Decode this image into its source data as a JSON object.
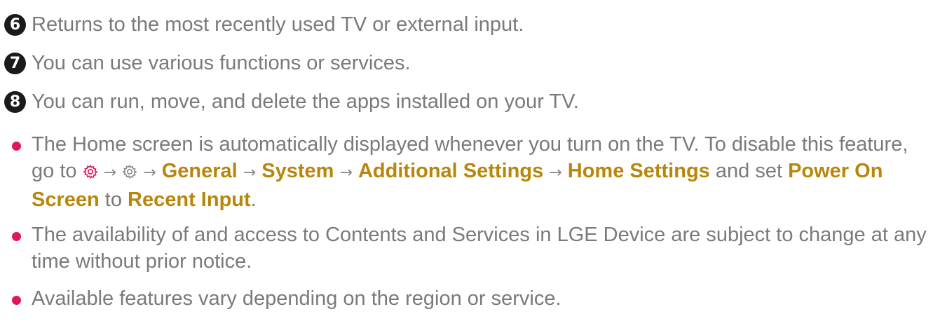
{
  "numbered_items": [
    {
      "number": "6",
      "text": "Returns to the most recently used TV or external input."
    },
    {
      "number": "7",
      "text": "You can use various functions or services."
    },
    {
      "number": "8",
      "text": "You can run, move, and delete the apps installed on your TV."
    }
  ],
  "notes": {
    "home_screen": {
      "intro": "The Home screen is automatically displayed whenever you turn on the TV. To disable this feature, go to",
      "arrow": "→",
      "path": [
        "General",
        "System",
        "Additional Settings",
        "Home Settings"
      ],
      "and_text": "and",
      "set_text": "set",
      "option": "Power On Screen",
      "to_text": "to",
      "value": "Recent Input",
      "period": ".",
      "icons": [
        "settings-gear-icon-red",
        "settings-gear-icon-gray"
      ]
    },
    "availability": "The availability of and access to Contents and Services in LGE Device are subject to change at any time without prior notice.",
    "features": "Available features vary depending on the region or service."
  },
  "colors": {
    "body_text": "#7a7a7a",
    "highlight": "#b8860b",
    "bullet": "#e0185a",
    "badge": "#1a1a1a",
    "gear_red": "#e0185a",
    "gear_gray": "#8a8a8a"
  }
}
